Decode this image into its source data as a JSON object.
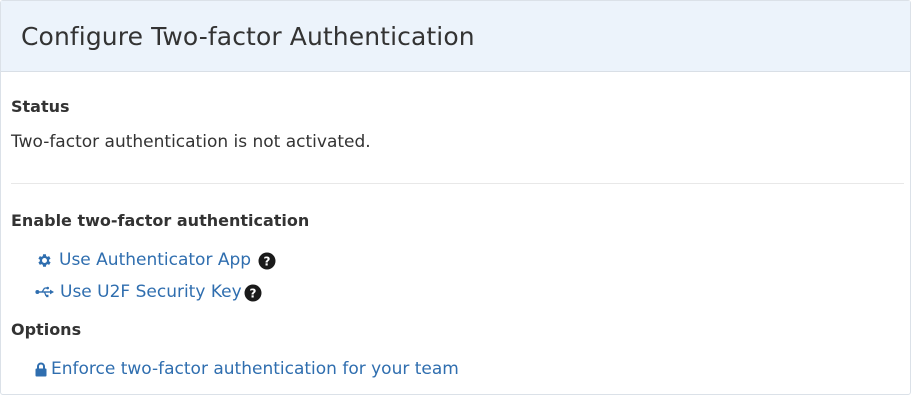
{
  "header": {
    "title": "Configure Two-factor Authentication"
  },
  "status": {
    "heading": "Status",
    "text": "Two-factor authentication is not activated."
  },
  "enable": {
    "heading": "Enable two-factor authentication",
    "methods": [
      {
        "label": "Use Authenticator App",
        "icon": "gear-icon",
        "help_icon": "question-circle-icon"
      },
      {
        "label": "Use U2F Security Key",
        "icon": "usb-icon",
        "help_icon": "question-circle-icon"
      }
    ]
  },
  "options": {
    "heading": "Options",
    "enforce_label": "Enforce two-factor authentication for your team",
    "enforce_icon": "lock-icon"
  },
  "colors": {
    "header_bg": "#ecf3fb",
    "link": "#2f6eaf",
    "text": "#333333"
  }
}
